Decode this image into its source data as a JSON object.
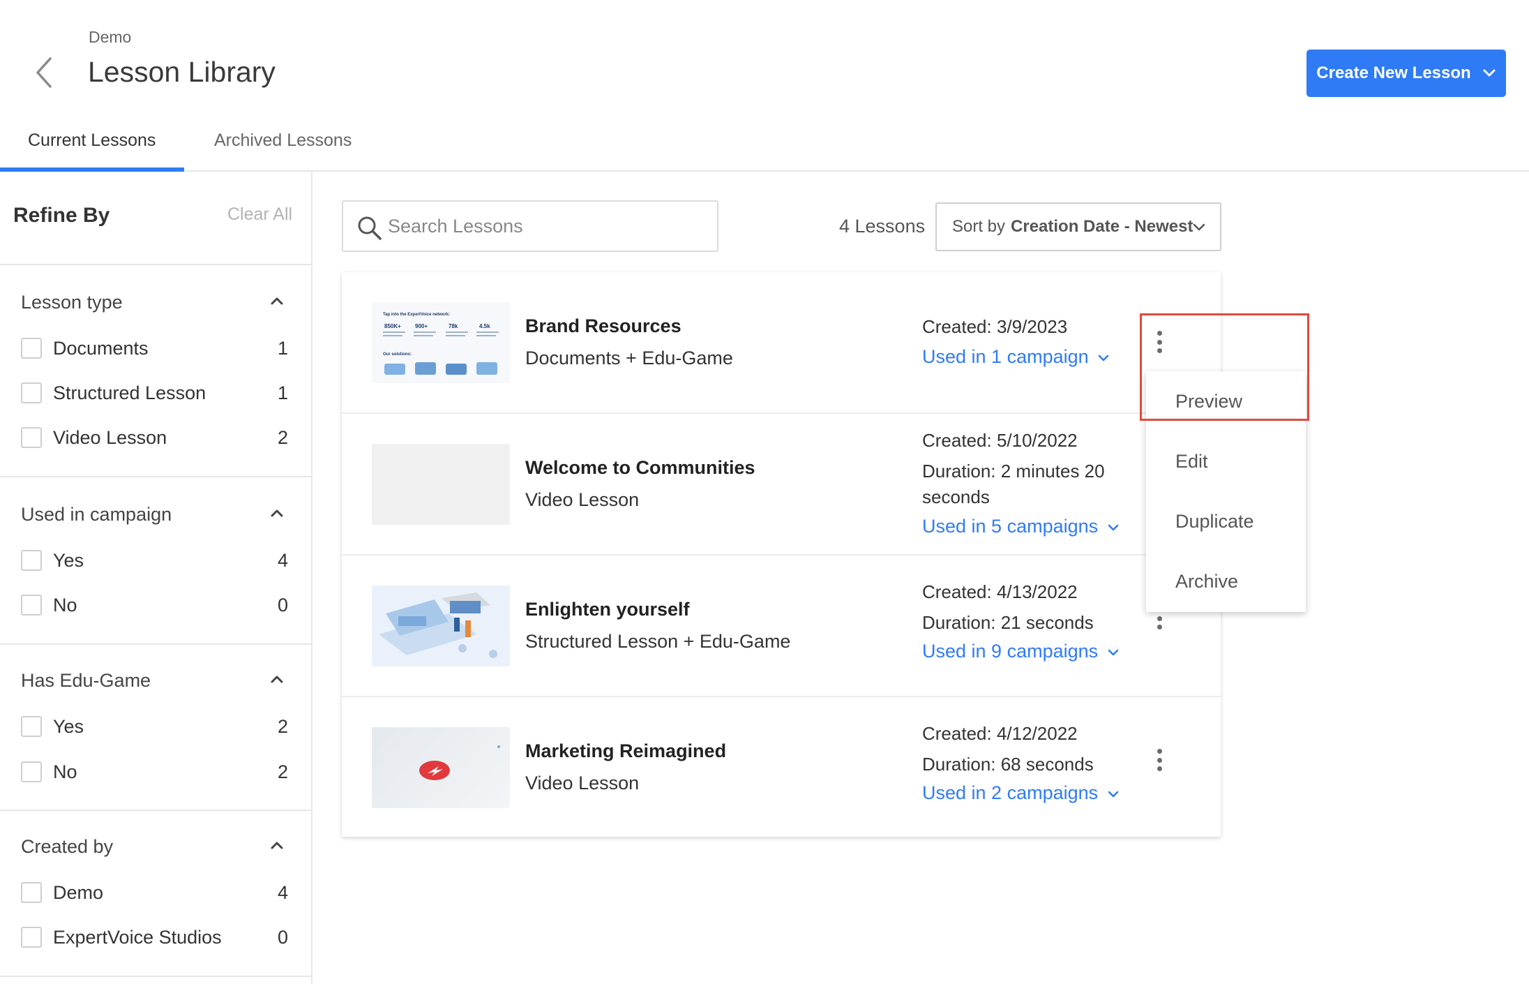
{
  "header": {
    "breadcrumb": "Demo",
    "title": "Lesson Library",
    "create_button": "Create New Lesson"
  },
  "tabs": [
    {
      "label": "Current Lessons",
      "active": true
    },
    {
      "label": "Archived Lessons",
      "active": false
    }
  ],
  "sidebar": {
    "title": "Refine By",
    "clear_all": "Clear All",
    "groups": [
      {
        "title": "Lesson type",
        "options": [
          {
            "label": "Documents",
            "count": "1"
          },
          {
            "label": "Structured Lesson",
            "count": "1"
          },
          {
            "label": "Video Lesson",
            "count": "2"
          }
        ]
      },
      {
        "title": "Used in campaign",
        "options": [
          {
            "label": "Yes",
            "count": "4"
          },
          {
            "label": "No",
            "count": "0"
          }
        ]
      },
      {
        "title": "Has Edu-Game",
        "options": [
          {
            "label": "Yes",
            "count": "2"
          },
          {
            "label": "No",
            "count": "2"
          }
        ]
      },
      {
        "title": "Created by",
        "options": [
          {
            "label": "Demo",
            "count": "4"
          },
          {
            "label": "ExpertVoice Studios",
            "count": "0"
          }
        ]
      }
    ]
  },
  "toolbar": {
    "search_placeholder": "Search Lessons",
    "lesson_count": "4 Lessons",
    "sort_prefix": "Sort by",
    "sort_value": "Creation Date - Newest"
  },
  "thumb1_text": {
    "heading": "Tap into the ExpertVoice network:",
    "stats": [
      "850K+",
      "900+",
      "78k",
      "4.5k"
    ],
    "solutions": "Our solutions:"
  },
  "lessons": [
    {
      "title": "Brand Resources",
      "type": "Documents + Edu-Game",
      "created": "Created: 3/9/2023",
      "used": "Used in 1 campaign"
    },
    {
      "title": "Welcome to Communities",
      "type": "Video Lesson",
      "created": "Created: 5/10/2022",
      "duration": "Duration: 2 minutes 20 seconds",
      "used": "Used in 5 campaigns"
    },
    {
      "title": "Enlighten yourself",
      "type": "Structured Lesson + Edu-Game",
      "created": "Created: 4/13/2022",
      "duration": "Duration: 21 seconds",
      "used": "Used in 9 campaigns"
    },
    {
      "title": "Marketing Reimagined",
      "type": "Video Lesson",
      "created": "Created: 4/12/2022",
      "duration": "Duration: 68 seconds",
      "used": "Used in 2 campaigns"
    }
  ],
  "menu": {
    "items": [
      "Preview",
      "Edit",
      "Duplicate",
      "Archive"
    ]
  },
  "colors": {
    "accent": "#2f7bf5",
    "highlight": "#e04a3a"
  }
}
